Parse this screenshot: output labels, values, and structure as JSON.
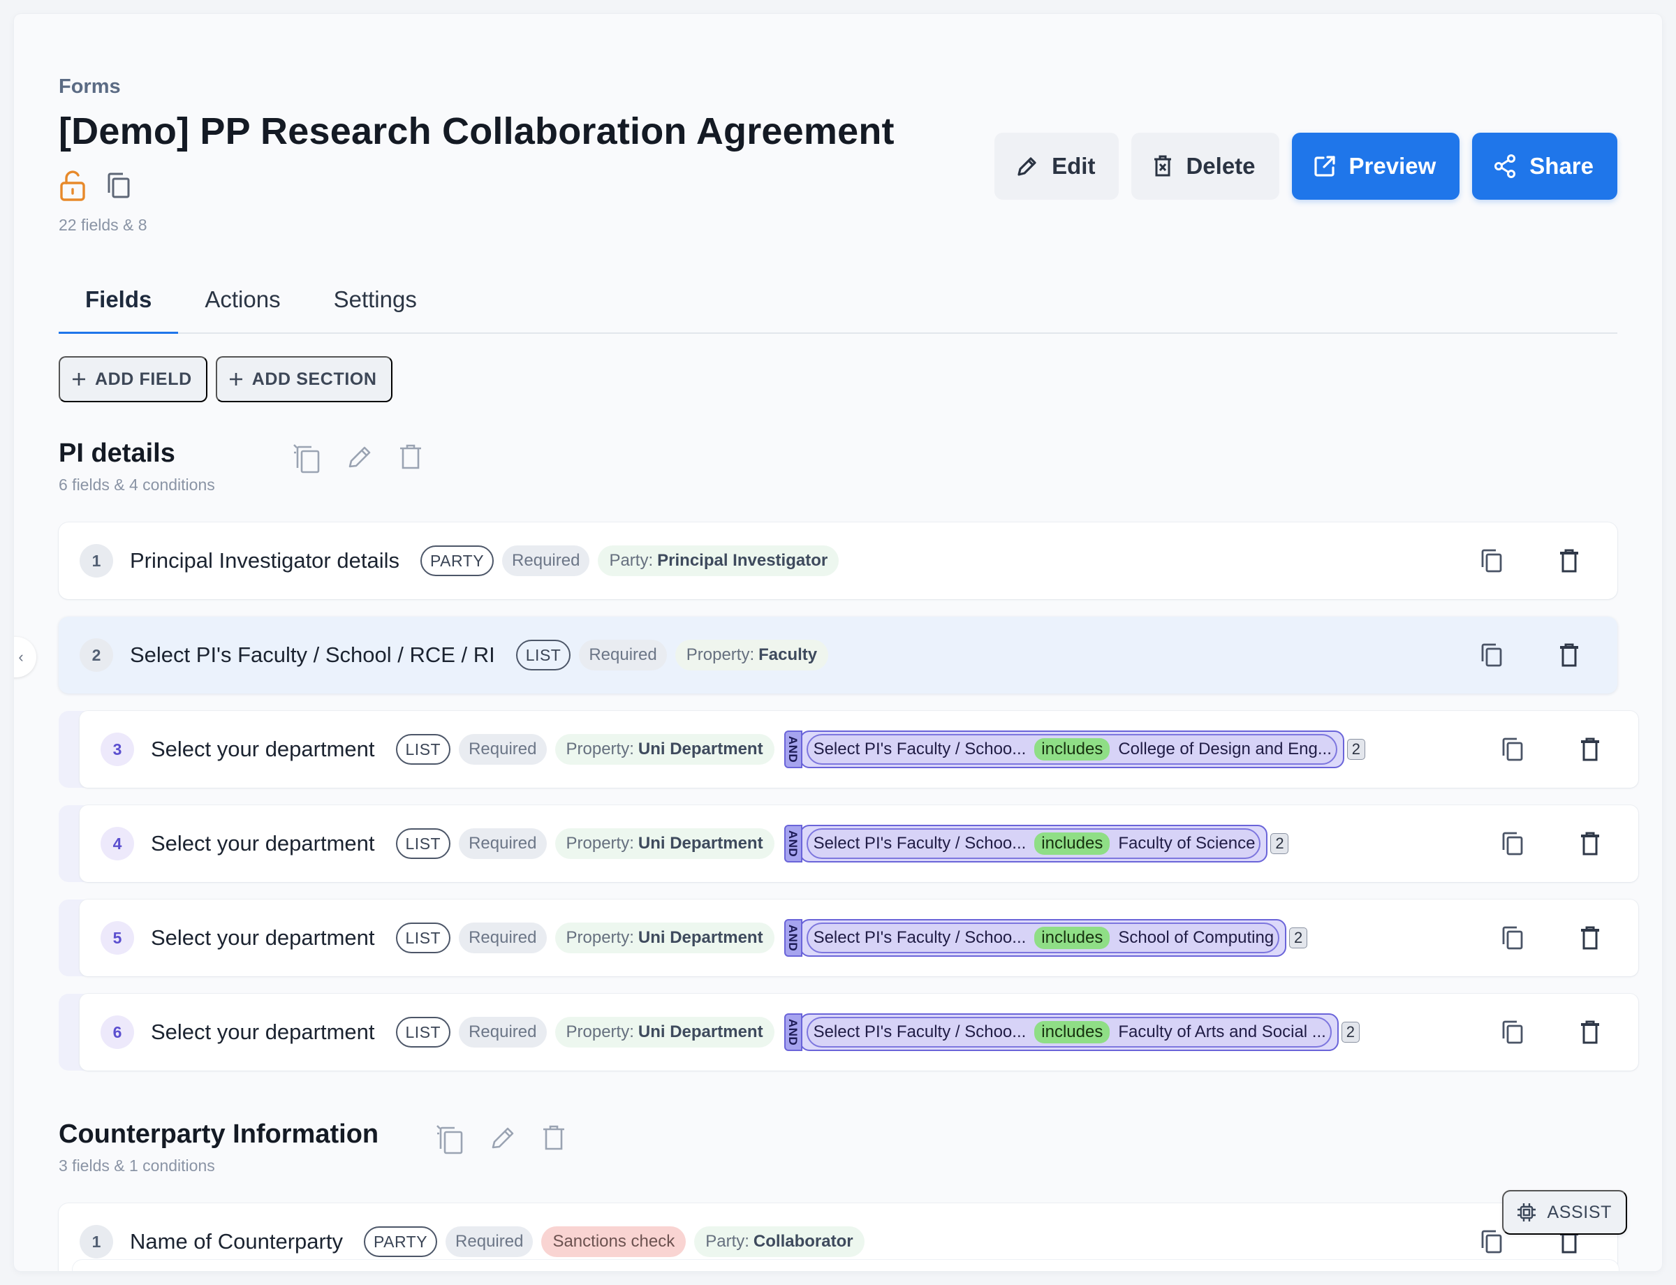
{
  "header": {
    "breadcrumb": "Forms",
    "title": "[Demo] PP Research Collaboration Agreement",
    "meta": "22 fields & 8",
    "icons": [
      "unlock-icon",
      "copy-icon"
    ]
  },
  "actions": {
    "edit": "Edit",
    "delete": "Delete",
    "preview": "Preview",
    "share": "Share"
  },
  "tabs": [
    {
      "label": "Fields",
      "active": true
    },
    {
      "label": "Actions",
      "active": false
    },
    {
      "label": "Settings",
      "active": false
    }
  ],
  "toolbar": {
    "add_field": "ADD FIELD",
    "add_section": "ADD SECTION"
  },
  "sections": [
    {
      "title": "PI details",
      "meta": "6 fields & 4 conditions",
      "rows": [
        {
          "num": "1",
          "name": "Principal Investigator details",
          "type": "PARTY",
          "required": "Required",
          "prop_label": "Party:",
          "prop_value": "Principal Investigator"
        },
        {
          "num": "2",
          "name": "Select PI's Faculty / School / RCE / RI",
          "type": "LIST",
          "required": "Required",
          "prop_label": "Property:",
          "prop_value": "Faculty"
        },
        {
          "num": "3",
          "name": "Select your department",
          "type": "LIST",
          "required": "Required",
          "prop_label": "Property:",
          "prop_value": "Uni Department",
          "cond_and": "AND",
          "cond_field": "Select PI's Faculty / Schoo...",
          "cond_op": "includes",
          "cond_value": "College of Design and Eng...",
          "cond_count": "2"
        },
        {
          "num": "4",
          "name": "Select your department",
          "type": "LIST",
          "required": "Required",
          "prop_label": "Property:",
          "prop_value": "Uni Department",
          "cond_and": "AND",
          "cond_field": "Select PI's Faculty / Schoo...",
          "cond_op": "includes",
          "cond_value": "Faculty of Science",
          "cond_count": "2"
        },
        {
          "num": "5",
          "name": "Select your department",
          "type": "LIST",
          "required": "Required",
          "prop_label": "Property:",
          "prop_value": "Uni Department",
          "cond_and": "AND",
          "cond_field": "Select PI's Faculty / Schoo...",
          "cond_op": "includes",
          "cond_value": "School of Computing",
          "cond_count": "2"
        },
        {
          "num": "6",
          "name": "Select your department",
          "type": "LIST",
          "required": "Required",
          "prop_label": "Property:",
          "prop_value": "Uni Department",
          "cond_and": "AND",
          "cond_field": "Select PI's Faculty / Schoo...",
          "cond_op": "includes",
          "cond_value": "Faculty of Arts and Social ...",
          "cond_count": "2"
        }
      ]
    },
    {
      "title": "Counterparty Information",
      "meta": "3 fields & 1 conditions",
      "rows": [
        {
          "num": "1",
          "name": "Name of Counterparty",
          "type": "PARTY",
          "required": "Required",
          "sanctions": "Sanctions check",
          "prop_label": "Party:",
          "prop_value": "Collaborator"
        }
      ]
    }
  ],
  "assist": {
    "label": "ASSIST"
  },
  "colors": {
    "primary": "#1f76ea",
    "unlock": "#e7892a",
    "condition": "#a6a4ef",
    "includes": "#8fde86",
    "sanctions": "#f9d4d2"
  }
}
